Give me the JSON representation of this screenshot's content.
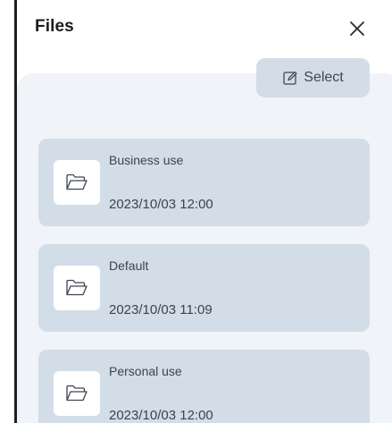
{
  "header": {
    "title": "Files",
    "close_icon": "close-icon"
  },
  "toolbar": {
    "select_label": "Select",
    "select_icon": "edit-icon"
  },
  "files": [
    {
      "name": "Business use",
      "date": "2023/10/03 12:00",
      "icon": "folder-icon"
    },
    {
      "name": "Default",
      "date": "2023/10/03 11:09",
      "icon": "folder-icon"
    },
    {
      "name": "Personal use",
      "date": "2023/10/03 12:00",
      "icon": "folder-icon"
    }
  ],
  "colors": {
    "panel_background": "#f0f3f8",
    "card_background": "#d2dde8",
    "text": "#3d4350",
    "title": "#1c1c1e"
  }
}
